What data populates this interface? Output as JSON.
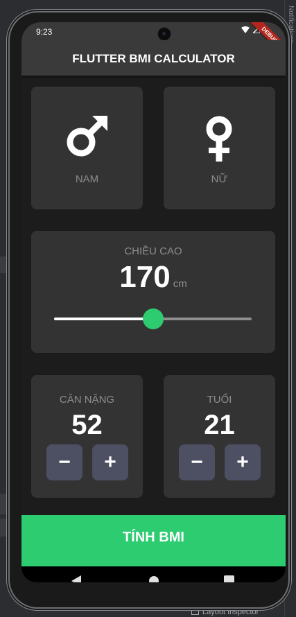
{
  "status_bar": {
    "time": "9:23",
    "icons": "▾◢▮"
  },
  "debug_banner": "DEBUG",
  "app_bar": {
    "title": "FLUTTER BMI CALCULATOR"
  },
  "gender": {
    "male": {
      "icon": "male-icon",
      "label": "NAM"
    },
    "female": {
      "icon": "female-icon",
      "label": "NỮ"
    }
  },
  "height": {
    "label": "CHIỀU CAO",
    "value": "170",
    "unit": "cm",
    "slider_fraction": 0.5
  },
  "weight": {
    "label": "CÂN NẶNG",
    "value": "52",
    "minus": "−",
    "plus": "+"
  },
  "age": {
    "label": "TUỔI",
    "value": "21",
    "minus": "−",
    "plus": "+"
  },
  "calculate_button": "TÍNH BMI",
  "ide": {
    "right_panel_title": "Notifications",
    "bottom_label": "Layout Inspector"
  },
  "colors": {
    "accent": "#2ecc71",
    "card": "#333333",
    "background": "#1c1c1c",
    "stepper": "#4d4f62"
  }
}
